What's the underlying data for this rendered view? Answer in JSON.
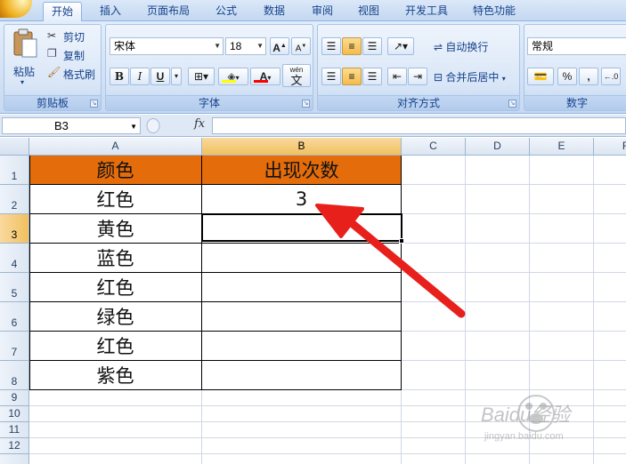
{
  "ribbon": {
    "tabs": [
      "开始",
      "插入",
      "页面布局",
      "公式",
      "数据",
      "审阅",
      "视图",
      "开发工具",
      "特色功能"
    ],
    "active_tab": "开始",
    "clipboard": {
      "paste": "粘贴",
      "cut": "剪切",
      "copy": "复制",
      "format_painter": "格式刷",
      "label": "剪贴板"
    },
    "font": {
      "name": "宋体",
      "size": "18",
      "bold": "B",
      "italic": "I",
      "underline": "U",
      "phonetic": "文",
      "phonetic_top": "wén",
      "label": "字体"
    },
    "alignment": {
      "wrap": "自动换行",
      "merge": "合并后居中",
      "label": "对齐方式"
    },
    "number": {
      "format": "常规",
      "percent": "%",
      "comma": ",",
      "label": "数字"
    }
  },
  "formula_bar": {
    "name_box": "B3",
    "fx": "fx",
    "content": ""
  },
  "sheet": {
    "columns": [
      "A",
      "B",
      "C",
      "D",
      "E",
      "F"
    ],
    "rows": [
      "1",
      "2",
      "3",
      "4",
      "5",
      "6",
      "7",
      "8",
      "9",
      "10",
      "11",
      "12"
    ],
    "header": {
      "a": "颜色",
      "b": "出现次数"
    },
    "colors": [
      "红色",
      "黄色",
      "蓝色",
      "红色",
      "绿色",
      "红色",
      "紫色"
    ],
    "counts": [
      "3",
      "",
      "",
      "",
      "",
      "",
      ""
    ],
    "selected_cell": "B3"
  },
  "watermark": {
    "text": "Baidu经验",
    "sub": "jingyan.baidu.com"
  },
  "accent": {
    "header_fill": "#e46c0a",
    "arrow": "#e8201c"
  }
}
